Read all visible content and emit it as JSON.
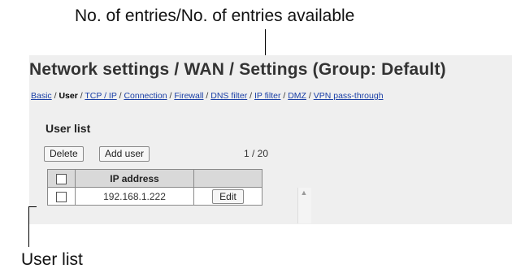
{
  "callouts": {
    "top": "No. of entries/No. of entries available",
    "bottom": "User list"
  },
  "page": {
    "title": "Network settings / WAN / Settings (Group: Default)"
  },
  "breadcrumb": {
    "items": [
      {
        "label": "Basic",
        "current": false
      },
      {
        "label": "User",
        "current": true
      },
      {
        "label": "TCP / IP",
        "current": false
      },
      {
        "label": "Connection",
        "current": false
      },
      {
        "label": "Firewall",
        "current": false
      },
      {
        "label": "DNS filter",
        "current": false
      },
      {
        "label": "IP filter",
        "current": false
      },
      {
        "label": "DMZ",
        "current": false
      },
      {
        "label": "VPN pass-through",
        "current": false
      }
    ],
    "separator": " / "
  },
  "user_list": {
    "title": "User list",
    "delete_label": "Delete",
    "add_label": "Add user",
    "count": "1 / 20",
    "columns": [
      "",
      "IP address",
      ""
    ],
    "rows": [
      {
        "checked": false,
        "ip": "192.168.1.222",
        "action": "Edit"
      }
    ]
  }
}
